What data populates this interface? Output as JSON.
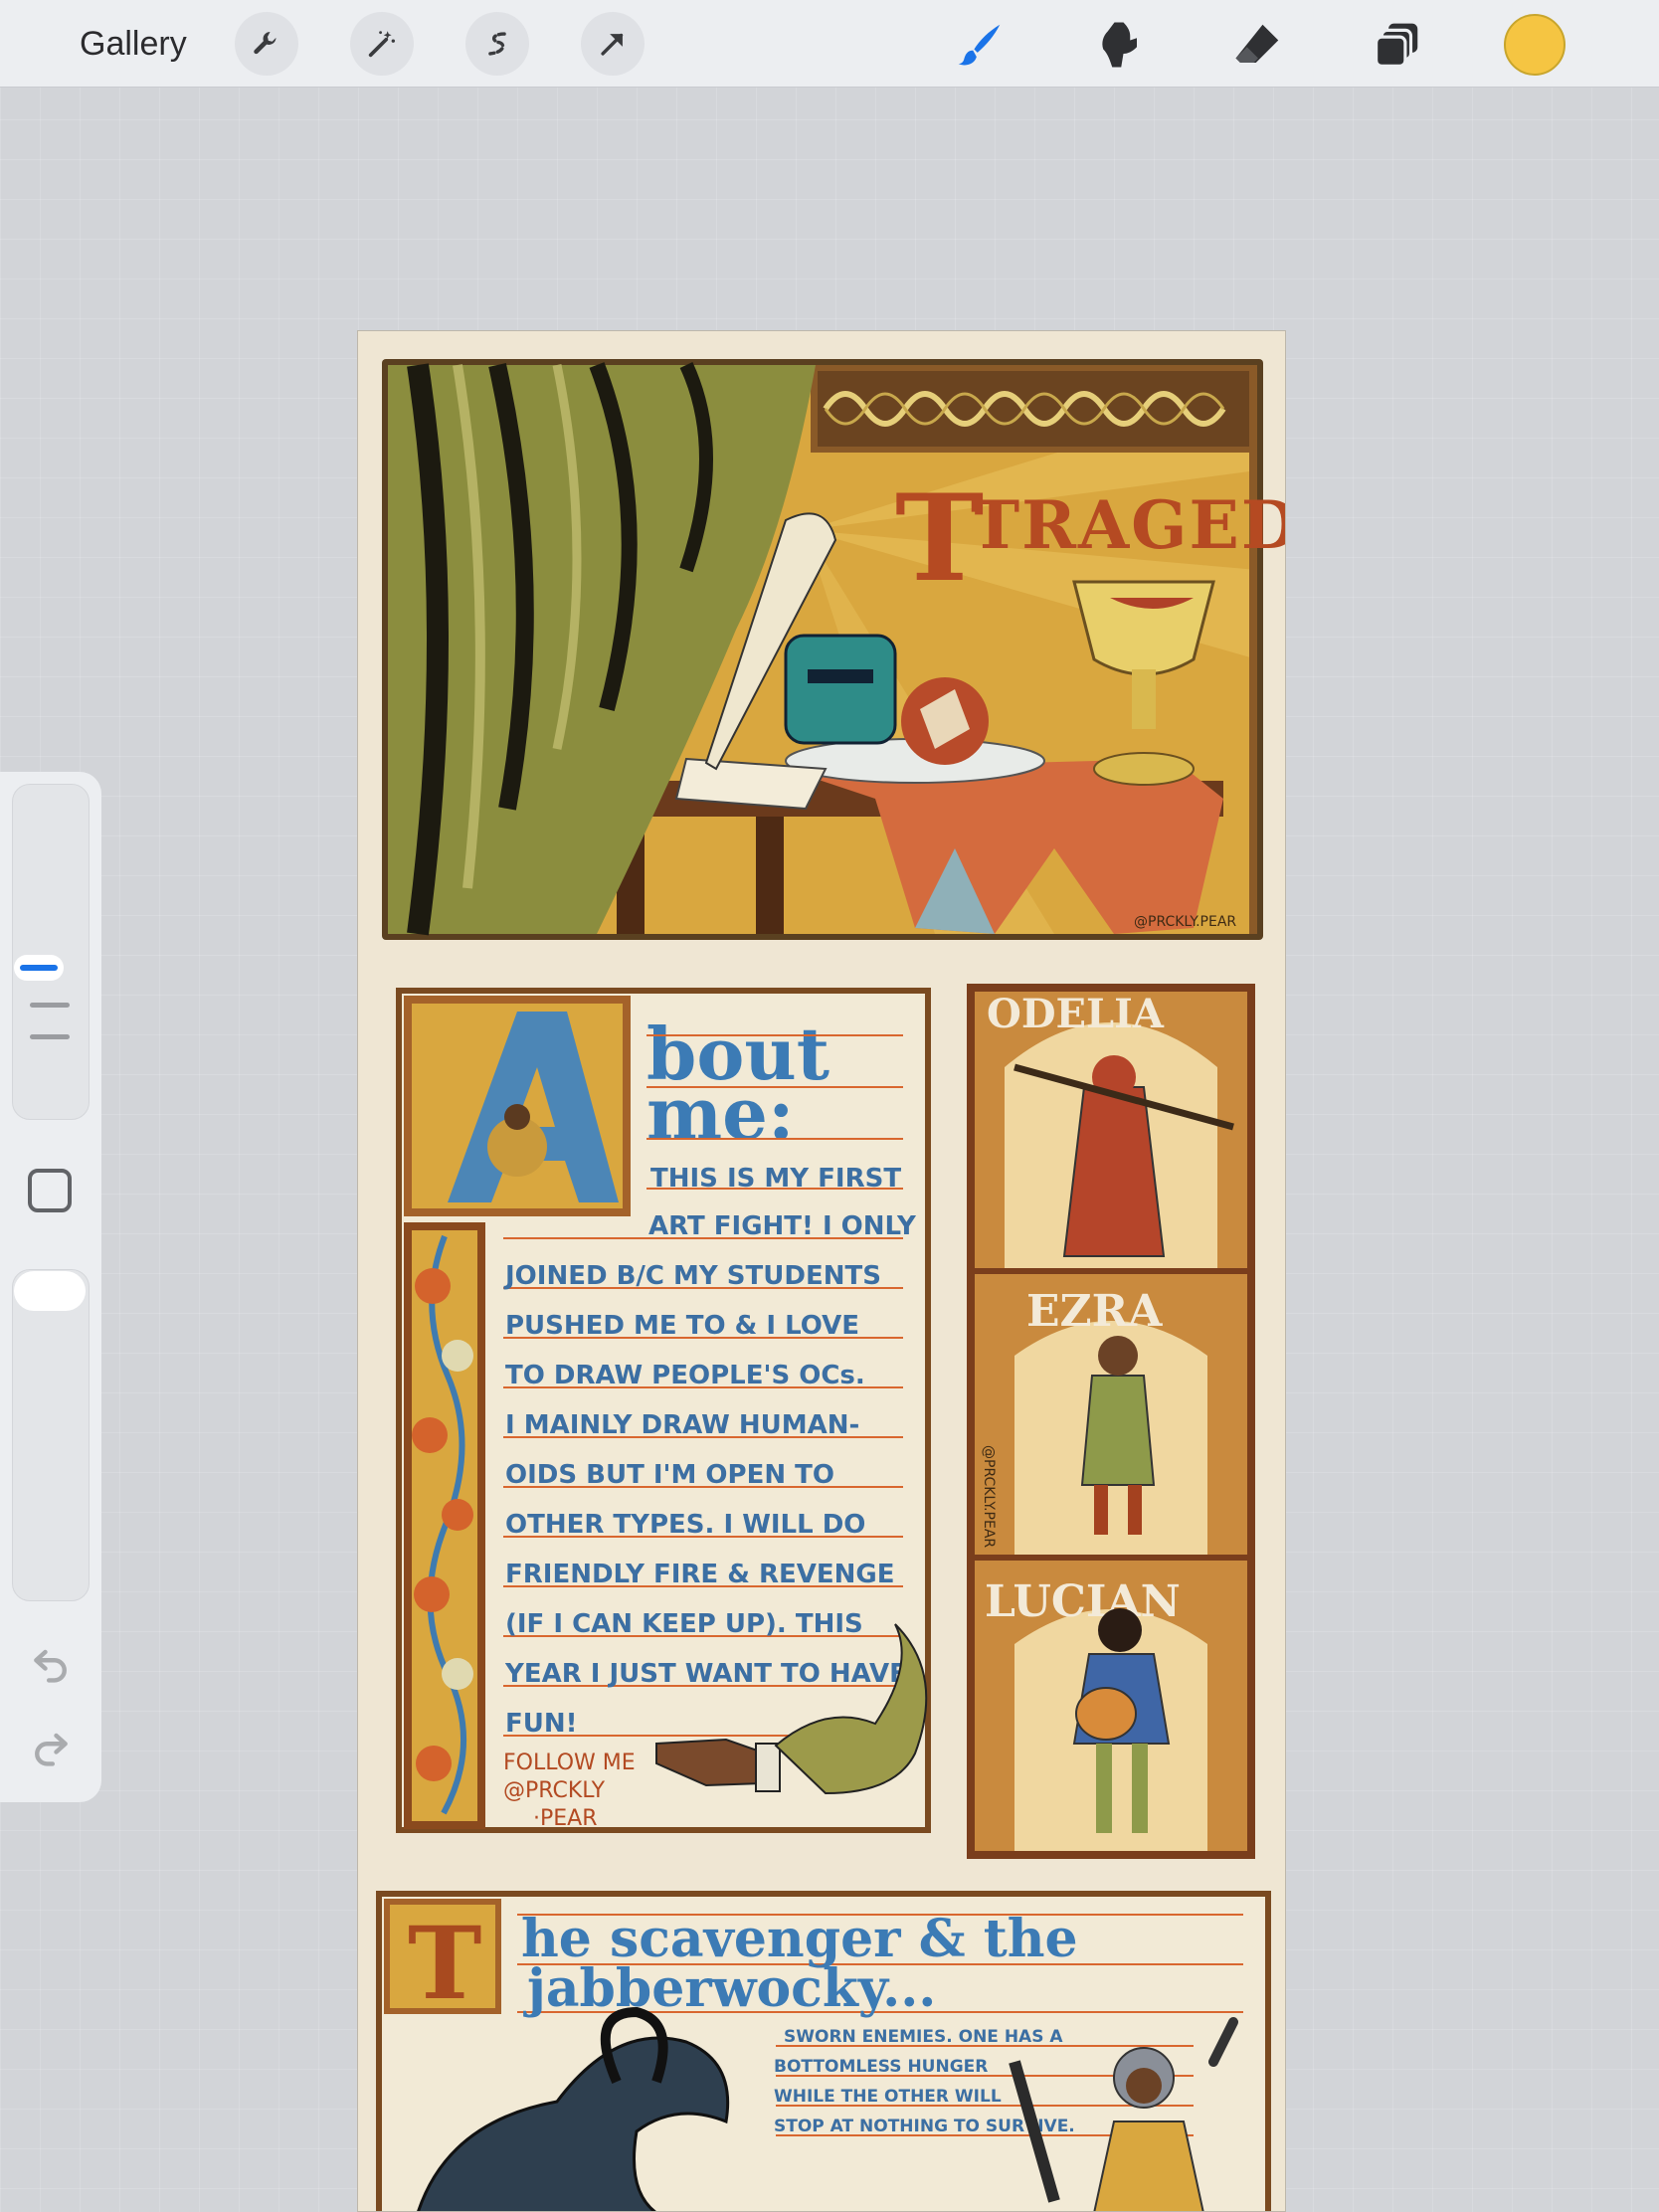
{
  "app": {
    "gallery_label": "Gallery",
    "color_swatch": "#f5c542",
    "accent": "#1a73e8"
  },
  "toolbar": {
    "left_tools": [
      "wrench-icon",
      "magic-wand-icon",
      "selection-icon",
      "transform-arrow-icon"
    ],
    "right_tools": [
      "brush-icon",
      "smudge-icon",
      "eraser-icon",
      "layers-icon"
    ],
    "active_tool": "brush"
  },
  "artwork": {
    "panel1": {
      "title": "TRAGEDY",
      "signature": "@PRCKLY.PEAR"
    },
    "panel2": {
      "heading_line1": "bout",
      "heading_line2": "me:",
      "drop_cap": "A",
      "body_lines": [
        "THIS IS MY FIRST",
        "ART FIGHT! I ONLY",
        "JOINED B/C MY STUDENTS",
        "PUSHED ME TO & I LOVE",
        "TO DRAW PEOPLE'S OCs.",
        "I MAINLY DRAW HUMAN-",
        "OIDS BUT I'M OPEN TO",
        "OTHER TYPES. I WILL DO",
        "FRIENDLY FIRE & REVENGE",
        "(IF I CAN KEEP UP). THIS",
        "YEAR I JUST WANT TO HAVE",
        "FUN!"
      ],
      "follow_lines": [
        "FOLLOW ME",
        "@PRCKLY",
        "·PEAR"
      ]
    },
    "characters": [
      {
        "name": "ODELIA"
      },
      {
        "name": "EZRA",
        "signature": "@PRCKLY.PEAR"
      },
      {
        "name": "LUCIAN"
      }
    ],
    "panel3": {
      "drop_cap": "T",
      "title_line1": "he scavenger & the",
      "title_line2": "jabberwocky...",
      "caption_lines": [
        "SWORN ENEMIES. ONE HAS A",
        "BOTTOMLESS HUNGER",
        "WHILE THE OTHER WILL",
        "STOP AT NOTHING TO SURVIVE."
      ]
    }
  }
}
